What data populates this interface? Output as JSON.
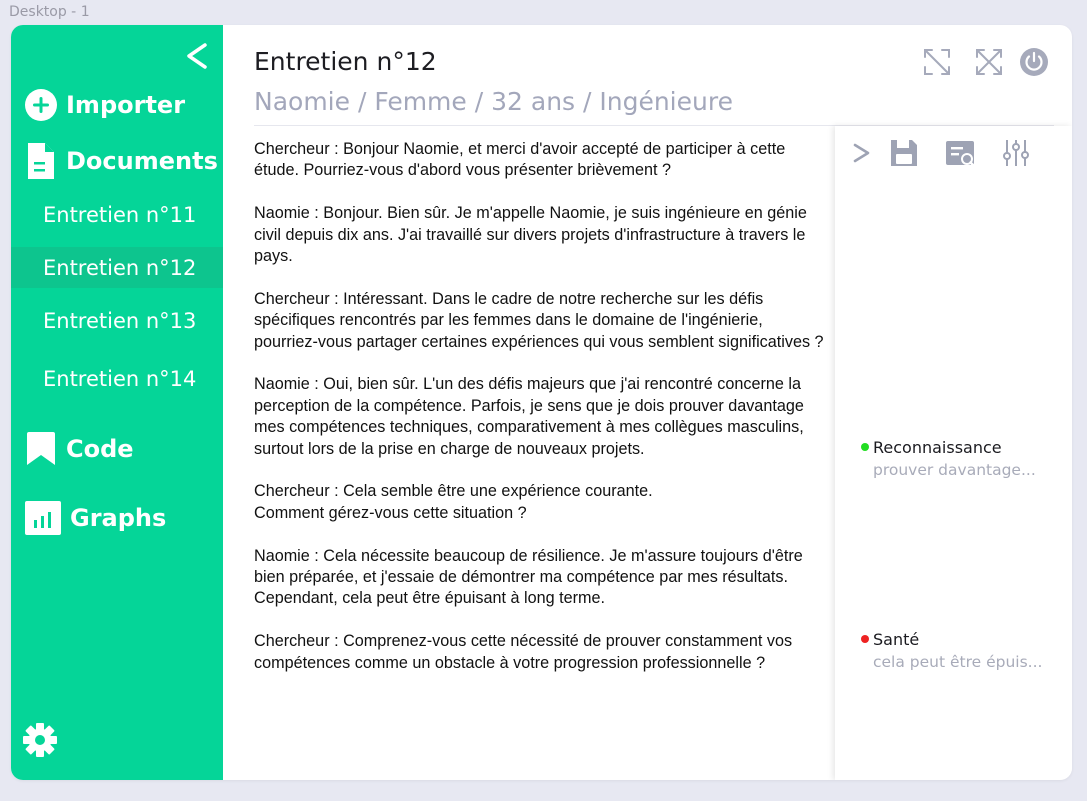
{
  "frame": {
    "label": "Desktop - 1"
  },
  "sidebar": {
    "collapse_label": "<",
    "import_label": "Importer",
    "documents_label": "Documents",
    "documents": [
      {
        "label": "Entretien n°11",
        "active": false
      },
      {
        "label": "Entretien n°12",
        "active": true
      },
      {
        "label": "Entretien n°13",
        "active": false
      },
      {
        "label": "Entretien n°14",
        "active": false
      }
    ],
    "code_label": "Code",
    "graphs_label": "Graphs"
  },
  "header": {
    "title": "Entretien n°12",
    "subtitle": "Naomie / Femme / 32 ans / Ingénieure"
  },
  "transcript": [
    "Chercheur : Bonjour Naomie, et merci d'avoir accepté de participer à cette étude. Pourriez-vous d'abord vous présenter brièvement ?",
    "Naomie : Bonjour. Bien sûr. Je m'appelle Naomie, je suis ingénieure en génie civil depuis dix ans. J'ai travaillé sur divers projets d'infrastructure à travers le pays.",
    "Chercheur : Intéressant. Dans le cadre de notre recherche sur les défis spécifiques rencontrés par les femmes dans le domaine de l'ingénierie, pourriez-vous partager certaines expériences qui vous semblent significatives ?",
    "Naomie : Oui, bien sûr. L'un des défis majeurs que j'ai rencontré concerne la perception de la compétence. Parfois, je sens que je dois prouver davantage mes compétences techniques, comparativement à mes collègues masculins, surtout lors de la prise en charge de nouveaux projets.",
    "Chercheur : Cela semble être une expérience courante.\nComment gérez-vous cette situation ?",
    "Naomie : Cela nécessite beaucoup de résilience. Je m'assure toujours d'être bien préparée, et j'essaie de démontrer ma compétence par mes résultats. Cependant, cela peut être épuisant à long terme.",
    "Chercheur : Comprenez-vous cette nécessité de prouver constamment vos compétences comme un obstacle à votre progression professionnelle ?"
  ],
  "panel": {
    "expand_label": ">",
    "codes": [
      {
        "name": "Reconnaissance",
        "excerpt": "prouver davantage...",
        "color": "#22dd22"
      },
      {
        "name": "Santé",
        "excerpt": "cela peut être épuis...",
        "color": "#ee2222"
      }
    ]
  },
  "icons": {
    "import": "plus-circle-icon",
    "documents": "document-icon",
    "code": "bookmark-icon",
    "graphs": "bar-chart-icon",
    "settings": "gear-icon",
    "save": "floppy-disk-icon",
    "search_doc": "document-search-icon",
    "filters": "sliders-icon",
    "expand": "expand-icon",
    "fullscreen": "fullscreen-icon",
    "power": "power-icon"
  },
  "colors": {
    "sidebar": "#05d598",
    "active_item": "#0dc58e",
    "subtitle": "#a3a7bb",
    "icon_gray": "#9ea3b4"
  }
}
